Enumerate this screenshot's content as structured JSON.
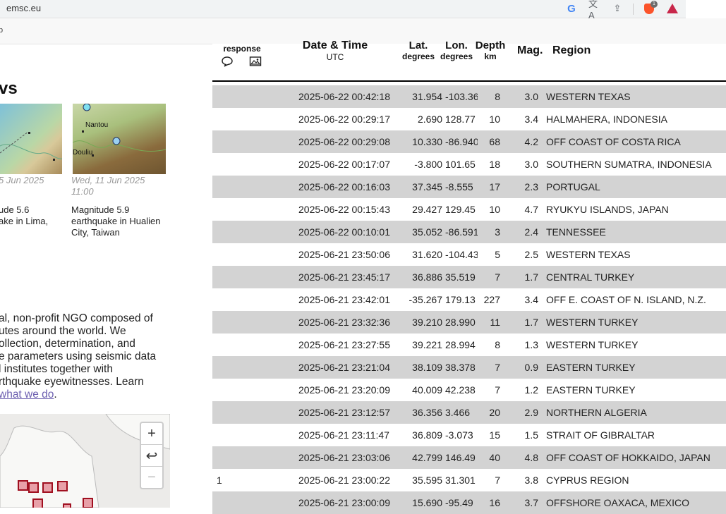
{
  "browser": {
    "url": "emsc.eu",
    "subbar_text": "p"
  },
  "news": {
    "title": "vs",
    "items": [
      {
        "date": "5 Jun 2025",
        "caption_lines": [
          "ude 5.6",
          "ake in Lima,"
        ]
      },
      {
        "date_lines": [
          "Wed, 11 Jun 2025",
          "11:00"
        ],
        "caption_lines": [
          "Magnitude 5.9",
          "earthquake in Hualien",
          "City, Taiwan"
        ],
        "map_labels": [
          "Nantou",
          "Douliu"
        ]
      }
    ]
  },
  "about": {
    "lines": [
      "al, non-profit NGO composed of",
      "utes around the world. We",
      "ollection, determination, and",
      "e parameters using seismic data",
      "l institutes together with",
      "rthquake eyewitnesses. Learn"
    ],
    "link_text": "what we do",
    "trailing": "."
  },
  "map_controls": {
    "zoom_in": "+",
    "reset": "↩",
    "zoom_out": "−"
  },
  "table": {
    "headers": {
      "response": "response",
      "date": "Date & Time",
      "date_unit": "UTC",
      "lat": "Lat.",
      "lat_unit": "degrees",
      "lon": "Lon.",
      "lon_unit": "degrees",
      "depth": "Depth",
      "depth_unit": "km",
      "mag": "Mag.",
      "region": "Region"
    },
    "rows": [
      {
        "resp": "",
        "date": "2025-06-22 00:42:18",
        "lat": "31.954",
        "lon": "-103.36",
        "depth": "8",
        "mag": "3.0",
        "region": "WESTERN TEXAS"
      },
      {
        "resp": "",
        "date": "2025-06-22 00:29:17",
        "lat": "2.690",
        "lon": "128.77",
        "depth": "10",
        "mag": "3.4",
        "region": "HALMAHERA, INDONESIA"
      },
      {
        "resp": "",
        "date": "2025-06-22 00:29:08",
        "lat": "10.330",
        "lon": "-86.940",
        "depth": "68",
        "mag": "4.2",
        "region": "OFF COAST OF COSTA RICA"
      },
      {
        "resp": "",
        "date": "2025-06-22 00:17:07",
        "lat": "-3.800",
        "lon": "101.65",
        "depth": "18",
        "mag": "3.0",
        "region": "SOUTHERN SUMATRA, INDONESIA"
      },
      {
        "resp": "",
        "date": "2025-06-22 00:16:03",
        "lat": "37.345",
        "lon": "-8.555",
        "depth": "17",
        "mag": "2.3",
        "region": "PORTUGAL"
      },
      {
        "resp": "",
        "date": "2025-06-22 00:15:43",
        "lat": "29.427",
        "lon": "129.45",
        "depth": "10",
        "mag": "4.7",
        "region": "RYUKYU ISLANDS, JAPAN"
      },
      {
        "resp": "",
        "date": "2025-06-22 00:10:01",
        "lat": "35.052",
        "lon": "-86.591",
        "depth": "3",
        "mag": "2.4",
        "region": "TENNESSEE"
      },
      {
        "resp": "",
        "date": "2025-06-21 23:50:06",
        "lat": "31.620",
        "lon": "-104.43",
        "depth": "5",
        "mag": "2.5",
        "region": "WESTERN TEXAS"
      },
      {
        "resp": "",
        "date": "2025-06-21 23:45:17",
        "lat": "36.886",
        "lon": "35.519",
        "depth": "7",
        "mag": "1.7",
        "region": "CENTRAL TURKEY"
      },
      {
        "resp": "",
        "date": "2025-06-21 23:42:01",
        "lat": "-35.267",
        "lon": "179.13",
        "depth": "227",
        "mag": "3.4",
        "region": "OFF E. COAST OF N. ISLAND, N.Z."
      },
      {
        "resp": "",
        "date": "2025-06-21 23:32:36",
        "lat": "39.210",
        "lon": "28.990",
        "depth": "11",
        "mag": "1.7",
        "region": "WESTERN TURKEY"
      },
      {
        "resp": "",
        "date": "2025-06-21 23:27:55",
        "lat": "39.221",
        "lon": "28.994",
        "depth": "8",
        "mag": "1.3",
        "region": "WESTERN TURKEY"
      },
      {
        "resp": "",
        "date": "2025-06-21 23:21:04",
        "lat": "38.109",
        "lon": "38.378",
        "depth": "7",
        "mag": "0.9",
        "region": "EASTERN TURKEY"
      },
      {
        "resp": "",
        "date": "2025-06-21 23:20:09",
        "lat": "40.009",
        "lon": "42.238",
        "depth": "7",
        "mag": "1.2",
        "region": "EASTERN TURKEY"
      },
      {
        "resp": "",
        "date": "2025-06-21 23:12:57",
        "lat": "36.356",
        "lon": "3.466",
        "depth": "20",
        "mag": "2.9",
        "region": "NORTHERN ALGERIA"
      },
      {
        "resp": "",
        "date": "2025-06-21 23:11:47",
        "lat": "36.809",
        "lon": "-3.073",
        "depth": "15",
        "mag": "1.5",
        "region": "STRAIT OF GIBRALTAR"
      },
      {
        "resp": "",
        "date": "2025-06-21 23:03:06",
        "lat": "42.799",
        "lon": "146.49",
        "depth": "40",
        "mag": "4.8",
        "region": "OFF COAST OF HOKKAIDO, JAPAN"
      },
      {
        "resp": "1",
        "date": "2025-06-21 23:00:22",
        "lat": "35.595",
        "lon": "31.301",
        "depth": "7",
        "mag": "3.8",
        "region": "CYPRUS REGION"
      },
      {
        "resp": "",
        "date": "2025-06-21 23:00:09",
        "lat": "15.690",
        "lon": "-95.49",
        "depth": "16",
        "mag": "3.7",
        "region": "OFFSHORE OAXACA, MEXICO"
      }
    ]
  }
}
